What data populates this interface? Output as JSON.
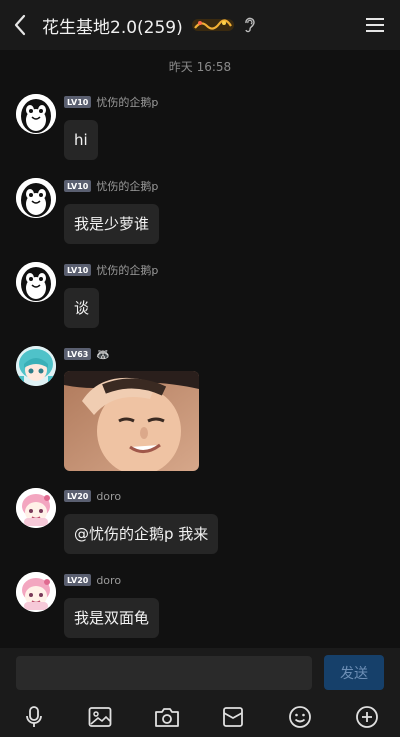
{
  "header": {
    "title": "花生基地2.0(259)"
  },
  "timestamp": "昨天 16:58",
  "messages": [
    {
      "level": "LV10",
      "nickname": "忧伤的企鹅p",
      "text": "hi"
    },
    {
      "level": "LV10",
      "nickname": "忧伤的企鹅p",
      "text": "我是少萝谁"
    },
    {
      "level": "LV10",
      "nickname": "忧伤的企鹅p",
      "text": "谈"
    },
    {
      "level": "LV63",
      "nickname": "🦝",
      "text": ""
    },
    {
      "level": "LV20",
      "nickname": "doro",
      "text": "@忧伤的企鹅p 我来"
    },
    {
      "level": "LV20",
      "nickname": "doro",
      "text": "我是双面龟"
    }
  ],
  "input": {
    "placeholder": "",
    "send_label": "发送"
  },
  "toolbar": [
    "microphone-icon",
    "image-icon",
    "camera-icon",
    "red-packet-icon",
    "emoji-icon",
    "plus-icon"
  ],
  "colors": {
    "background": "#111111",
    "bubble": "#262626",
    "send_button": "#16406a",
    "level_badge": "#5a5f70"
  }
}
